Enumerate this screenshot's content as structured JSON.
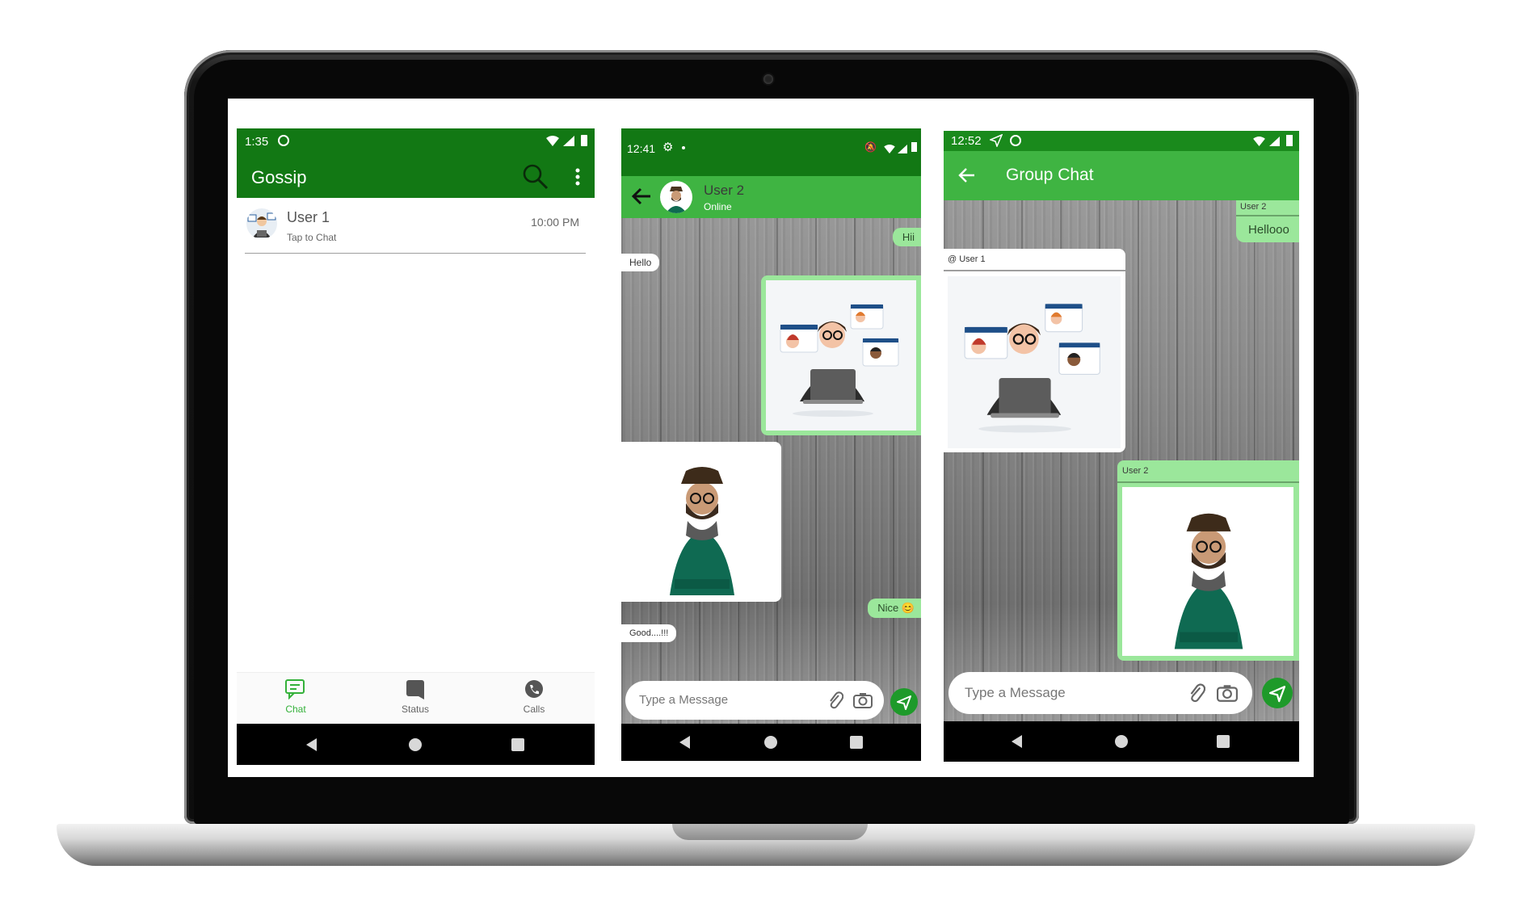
{
  "colors": {
    "primary_dark": "#127814",
    "primary": "#1a8a1c",
    "primary_light": "#4caf50",
    "bubble_green": "#9be79b",
    "send_green": "#1e9a2a"
  },
  "screen1": {
    "status_time": "1:35",
    "app_title": "Gossip",
    "chat_item": {
      "name": "User 1",
      "subtitle": "Tap to Chat",
      "time": "10:00 PM"
    },
    "bottom_tabs": [
      {
        "label": "Chat",
        "icon": "chat-icon",
        "active": true
      },
      {
        "label": "Status",
        "icon": "status-icon",
        "active": false
      },
      {
        "label": "Calls",
        "icon": "calls-icon",
        "active": false
      }
    ]
  },
  "screen2": {
    "status_time": "12:41",
    "contact_name": "User 2",
    "contact_status": "Online",
    "messages": [
      {
        "text": "Hii",
        "side": "out"
      },
      {
        "text": "Hello",
        "side": "in"
      },
      {
        "text": "Nice 😊",
        "side": "out"
      },
      {
        "text": "Good....!!!",
        "side": "in"
      }
    ],
    "input_placeholder": "Type a Message"
  },
  "screen3": {
    "status_time": "12:52",
    "title": "Group Chat",
    "messages": [
      {
        "sender": "User 2",
        "text": "Hellooo",
        "side": "out"
      },
      {
        "sender": "@ User 1",
        "side": "in",
        "kind": "image"
      },
      {
        "sender": "User 2",
        "side": "out",
        "kind": "image"
      }
    ],
    "input_placeholder": "Type a Message"
  }
}
